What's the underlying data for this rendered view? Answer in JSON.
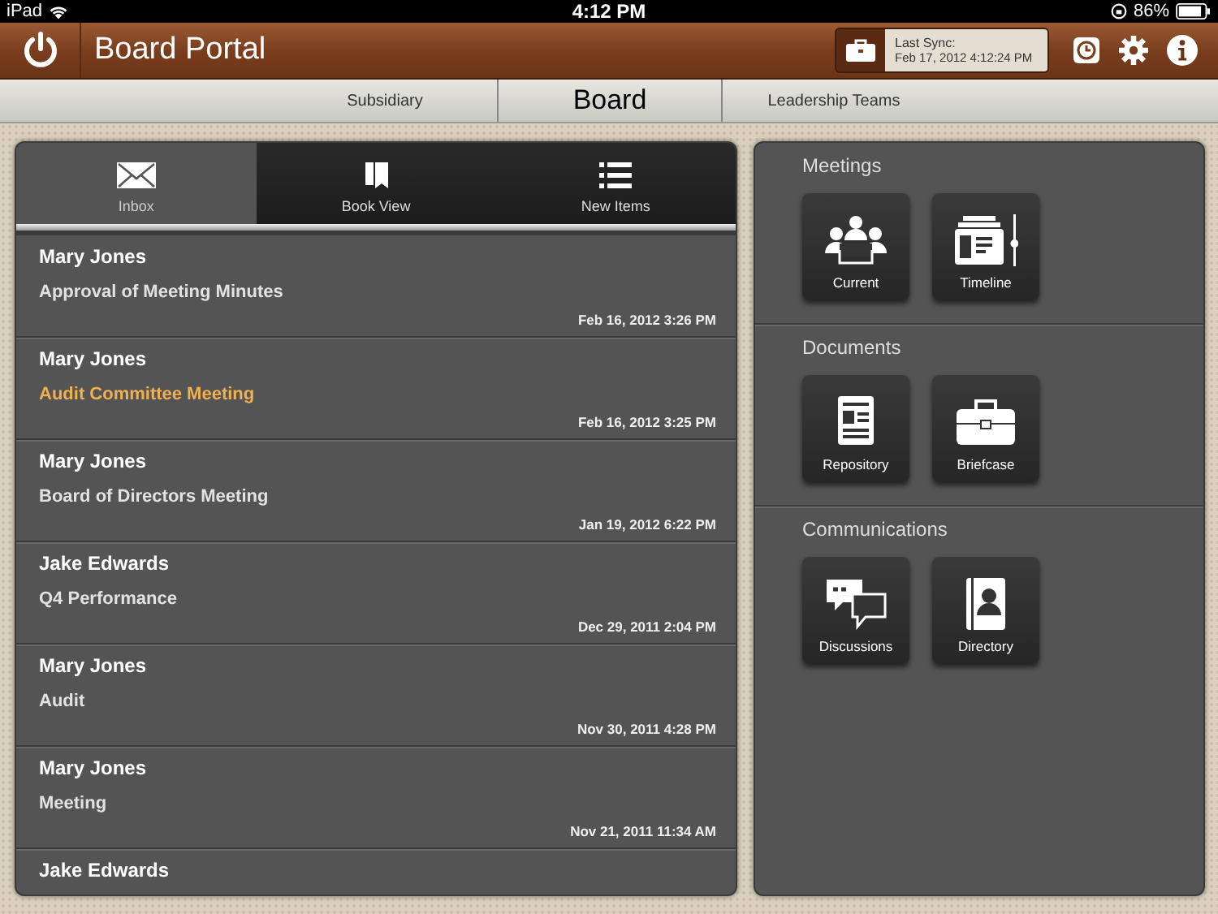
{
  "status_bar": {
    "carrier": "iPad",
    "time": "4:12 PM",
    "battery": "86%"
  },
  "header": {
    "title": "Board Portal",
    "sync_label": "Last Sync:",
    "sync_time": "Feb 17, 2012 4:12:24 PM"
  },
  "scope_tabs": [
    {
      "label": "Subsidiary",
      "selected": false
    },
    {
      "label": "Board",
      "selected": true
    },
    {
      "label": "Leadership Teams",
      "selected": false
    }
  ],
  "inbox_tabs": [
    {
      "label": "Inbox",
      "kind": "envelope",
      "selected": true
    },
    {
      "label": "Book View",
      "kind": "book",
      "selected": false
    },
    {
      "label": "New Items",
      "kind": "list",
      "selected": false
    }
  ],
  "messages": [
    {
      "sender": "Mary Jones",
      "subject": "Approval of Meeting Minutes",
      "date": "Feb 16, 2012 3:26 PM",
      "highlighted": false
    },
    {
      "sender": "Mary Jones",
      "subject": "Audit Committee Meeting",
      "date": "Feb 16, 2012 3:25 PM",
      "highlighted": true
    },
    {
      "sender": "Mary Jones",
      "subject": "Board of Directors Meeting",
      "date": "Jan 19, 2012 6:22 PM",
      "highlighted": false
    },
    {
      "sender": "Jake Edwards",
      "subject": "Q4 Performance",
      "date": "Dec 29, 2011 2:04 PM",
      "highlighted": false
    },
    {
      "sender": "Mary Jones",
      "subject": "Audit",
      "date": "Nov 30, 2011 4:28 PM",
      "highlighted": false
    },
    {
      "sender": "Mary Jones",
      "subject": "Meeting",
      "date": "Nov 21, 2011 11:34 AM",
      "highlighted": false
    },
    {
      "sender": "Jake Edwards"
    }
  ],
  "sections": [
    {
      "title": "Meetings",
      "buttons": [
        {
          "label": "Current",
          "kind": "meeting"
        },
        {
          "label": "Timeline",
          "kind": "timeline"
        }
      ]
    },
    {
      "title": "Documents",
      "buttons": [
        {
          "label": "Repository",
          "kind": "document"
        },
        {
          "label": "Briefcase",
          "kind": "briefcase"
        }
      ]
    },
    {
      "title": "Communications",
      "buttons": [
        {
          "label": "Discussions",
          "kind": "discussion"
        },
        {
          "label": "Directory",
          "kind": "contacts"
        }
      ]
    }
  ]
}
